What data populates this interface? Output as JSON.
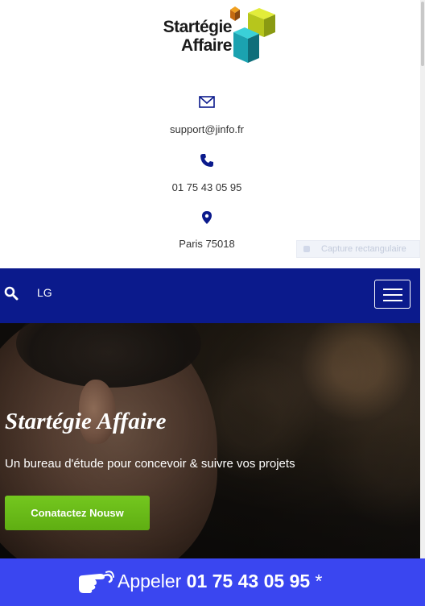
{
  "brand": {
    "logo_line1": "Startégie",
    "logo_line2": "Affaire",
    "colors": {
      "navy": "#0b1a8c",
      "green": "#6aba18",
      "call_blue": "#3a46f0"
    }
  },
  "contact": {
    "email_icon": "envelope-icon",
    "email": "support@jinfo.fr",
    "phone_icon": "phone-icon",
    "phone": "01 75 43 05 95",
    "location_icon": "map-pin-icon",
    "location": "Paris 75018"
  },
  "overlay": {
    "capture_label": "Capture rectangulaire"
  },
  "navbar": {
    "search_icon": "search-icon",
    "lang": "LG",
    "menu_icon": "hamburger-icon"
  },
  "hero": {
    "title": "Startégie Affaire",
    "subtitle": "Un bureau d'étude pour concevoir & suivre vos projets",
    "cta_label": "Conatactez Nousw"
  },
  "callbar": {
    "prefix": "Appeler",
    "number": "01 75 43 05 95",
    "suffix": "*",
    "icon": "pointing-hand-icon"
  }
}
